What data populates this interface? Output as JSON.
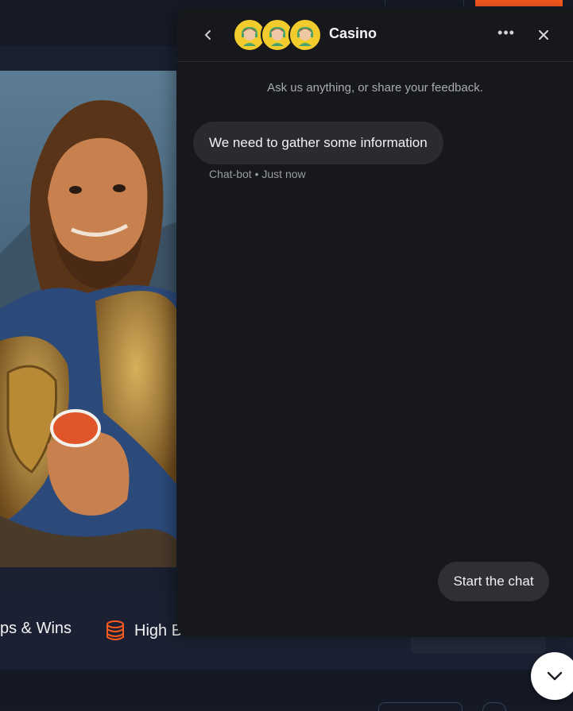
{
  "chat": {
    "title": "Casino",
    "intro": "Ask us anything, or share your feedback.",
    "message": {
      "text": "We need to gather some information",
      "sender": "Chat-bot",
      "separator": "•",
      "time": "Just now"
    },
    "start_button": "Start the chat",
    "icons": {
      "back": "chevron-left-icon",
      "more": "more-horizontal-icon",
      "close": "close-icon",
      "avatar": "support-agent-avatar",
      "minimize": "chevron-down-icon"
    },
    "more_glyph": "•••"
  },
  "promo": {
    "item1": "ps & Wins",
    "item2": "High Bo"
  },
  "colors": {
    "accent": "#ff5a1f",
    "avatar_bg": "#f2cc2c",
    "chat_bg": "#17181c",
    "bubble_bg": "#2a2b30",
    "page_bg": "#151a26"
  }
}
